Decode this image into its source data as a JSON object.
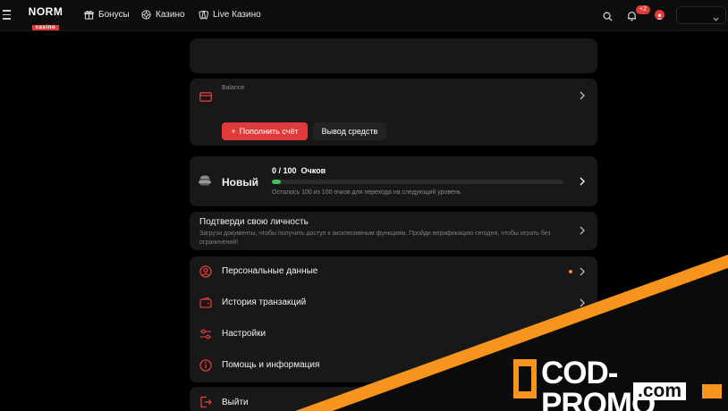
{
  "header": {
    "logo_main": "NORM",
    "logo_sub": "casino",
    "nav": [
      {
        "label": "Бонусы",
        "icon": "gift-icon"
      },
      {
        "label": "Казино",
        "icon": "chip-icon"
      },
      {
        "label": "Live Казино",
        "icon": "cards-icon"
      }
    ],
    "notifications_count": "+2"
  },
  "balance_card": {
    "label": "Balance",
    "topup_label": "Пополнить счёт",
    "withdraw_label": "Вывод средств"
  },
  "level_card": {
    "level_name": "Новый",
    "points": "0 / 100",
    "points_word": "Очков",
    "progress_percent": 3,
    "note": "Осталось 100 из 100 очков для перехода на следующий уровень"
  },
  "verify_card": {
    "title": "Подтверди свою личность",
    "text": "Загрузи документы, чтобы получить доступ к эксклюзивным функциям. Пройди верификацию сегодня, чтобы играть без ограничений!"
  },
  "menu": [
    {
      "label": "Персональные данные",
      "icon": "user-circle-icon",
      "dot": true
    },
    {
      "label": "История транзакций",
      "icon": "wallet-icon",
      "dot": false
    },
    {
      "label": "Настройки",
      "icon": "sliders-icon",
      "dot": false
    },
    {
      "label": "Помощь и информация",
      "icon": "info-icon",
      "dot": false
    }
  ],
  "logout_label": "Выйти",
  "watermark": {
    "main": "COD-PROMO",
    "sub": ".com"
  },
  "colors": {
    "accent": "#e13a3a",
    "progress": "#3fc25a",
    "card": "#181818",
    "background": "#000000",
    "watermark_orange": "#f7941d"
  }
}
